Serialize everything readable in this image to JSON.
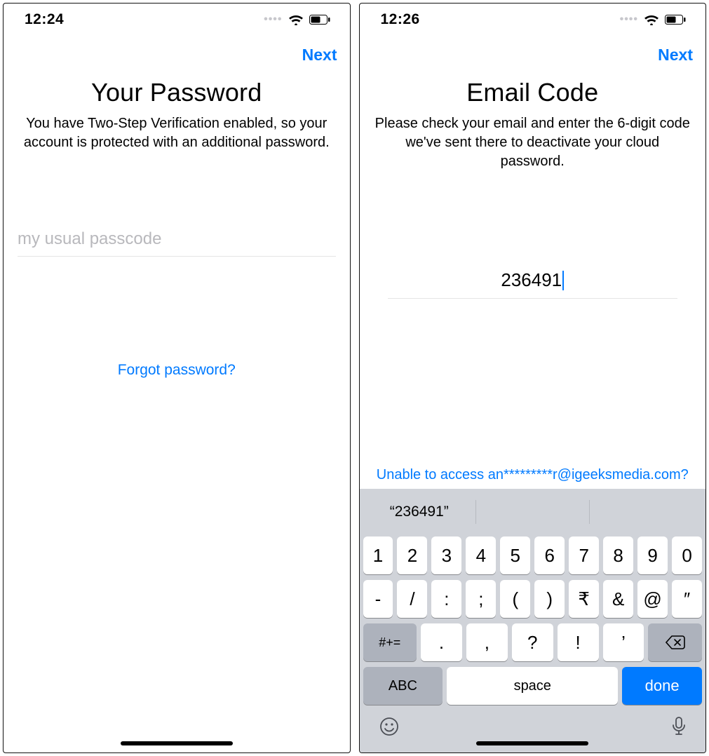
{
  "left": {
    "status_time": "12:24",
    "next_label": "Next",
    "title": "Your Password",
    "subtitle": "You have Two-Step Verification enabled, so your account is protected with an additional password.",
    "input_placeholder": "my usual passcode",
    "forgot_link": "Forgot password?"
  },
  "right": {
    "status_time": "12:26",
    "next_label": "Next",
    "title": "Email Code",
    "subtitle": "Please check your email and enter the 6-digit code we've sent there to deactivate your cloud password.",
    "input_value": "236491",
    "unable_link": "Unable to access an*********r@igeeksmedia.com?"
  },
  "keyboard": {
    "suggestion": "“236491”",
    "row1": [
      "1",
      "2",
      "3",
      "4",
      "5",
      "6",
      "7",
      "8",
      "9",
      "0"
    ],
    "row2": [
      "-",
      "/",
      ":",
      ";",
      "(",
      ")",
      "₹",
      "&",
      "@",
      "″"
    ],
    "row3_shift": "#+=",
    "row3": [
      ".",
      ",",
      "?",
      "!",
      "’"
    ],
    "abc": "ABC",
    "space": "space",
    "done": "done"
  }
}
